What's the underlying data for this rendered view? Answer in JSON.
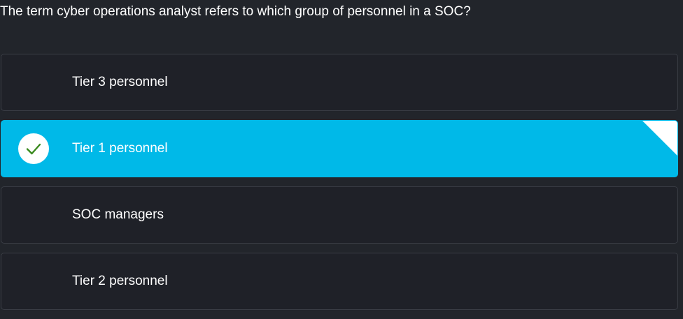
{
  "question": {
    "text": "The term cyber operations analyst refers to which group of personnel in a SOC?"
  },
  "options": [
    {
      "label": "Tier 3 personnel",
      "selected": false
    },
    {
      "label": "Tier 1 personnel",
      "selected": true
    },
    {
      "label": "SOC managers",
      "selected": false
    },
    {
      "label": "Tier 2 personnel",
      "selected": false
    }
  ],
  "colors": {
    "background": "#22252b",
    "option_background": "#1f2128",
    "selected_accent": "#00b9e8",
    "check_color": "#3a8a1e"
  },
  "icons": {
    "selected_marker": "checkmark-icon"
  }
}
